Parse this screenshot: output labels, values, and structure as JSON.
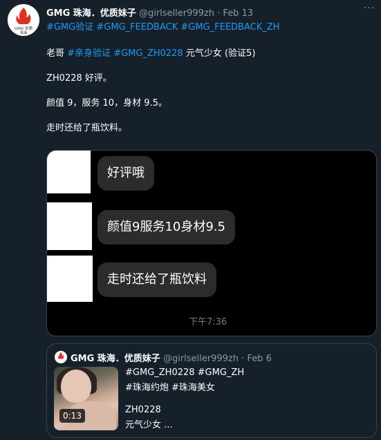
{
  "tweet": {
    "avatar_text": "GMG 优质",
    "avatar_subtext": "珠海",
    "display_name": "GMG 珠海．优质妹子",
    "handle": "@girlseller999zh",
    "separator": "·",
    "date": "Feb 13",
    "more_label": "···",
    "hashtags": "#GMG验证 #GMG_FEEDBACK #GMG_FEEDBACK_ZH",
    "line1_prefix": "老哥 ",
    "line1_tag1": "#亲身验证",
    "line1_tag2": "#GMG_ZH0228",
    "line1_suffix": " 元气少女 (验证5)",
    "line2": "ZH0228 好评。",
    "line3": "颜值 9，服务 10，身材 9.5。",
    "line4": "走时还给了瓶饮料。"
  },
  "chat_image": {
    "messages": [
      "好评哦",
      "颜值9服务10身材9.5",
      "走时还给了瓶饮料"
    ],
    "timestamp": "下午7:36"
  },
  "quote": {
    "display_name": "GMG 珠海．优质妹子",
    "handle": "@girlseller999zh",
    "separator": "·",
    "date": "Feb 6",
    "video_duration": "0:13",
    "text_line1": "#GMG_ZH0228 #GMG_ZH",
    "text_line2": "#珠海约炮 #珠海美女",
    "text_line3": "ZH0228",
    "text_line4": "元气少女 ..."
  },
  "colors": {
    "background": "#15202b",
    "link": "#1d9bf0",
    "muted": "#8b98a5",
    "border": "#38444d",
    "bubble": "#2c2c2e",
    "brand_red": "#e0301e"
  }
}
